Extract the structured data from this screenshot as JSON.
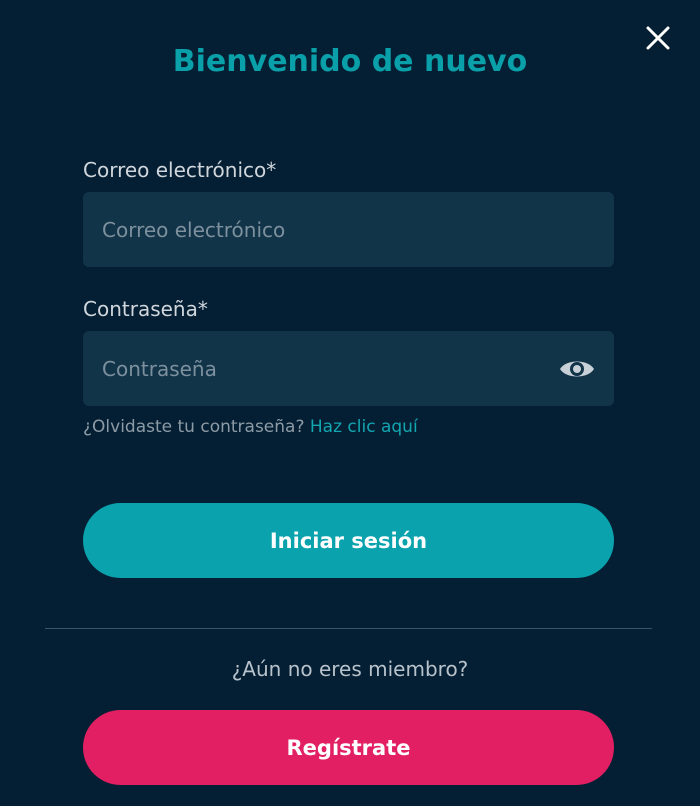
{
  "dialog": {
    "title": "Bienvenido de nuevo"
  },
  "email": {
    "label": "Correo electrónico*",
    "placeholder": "Correo electrónico",
    "value": ""
  },
  "password": {
    "label": "Contraseña*",
    "placeholder": "Contraseña",
    "value": ""
  },
  "forgot": {
    "text": "¿Olvidaste tu contraseña?",
    "link": "Haz clic aquí"
  },
  "login_button": "Iniciar sesión",
  "not_member": "¿Aún no eres miembro?",
  "register_button": "Regístrate",
  "icons": {
    "close": "close-icon",
    "show_password": "eye-icon"
  },
  "colors": {
    "background": "#041f33",
    "input_bg": "#123449",
    "accent": "#0aa3ad",
    "register": "#e21f63"
  }
}
